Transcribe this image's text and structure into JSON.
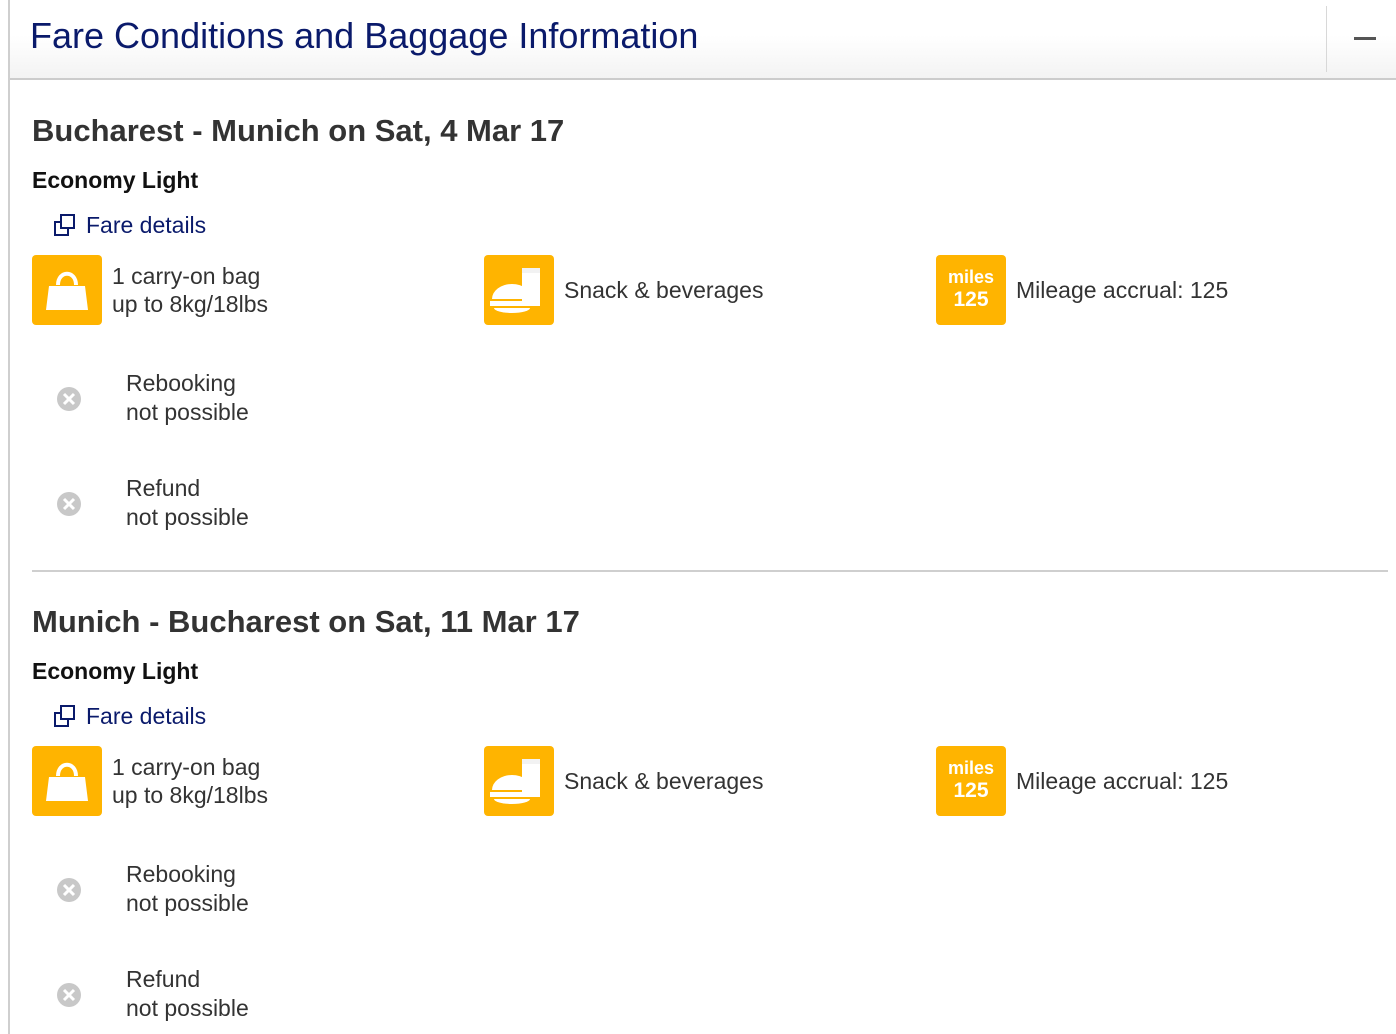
{
  "panel": {
    "title": "Fare Conditions and Baggage Information",
    "collapse_icon": "minus-icon"
  },
  "colors": {
    "accent": "#ffb400",
    "title_blue": "#0a1a6b",
    "text": "#333333",
    "disabled_icon": "#c8c8c8"
  },
  "flights": [
    {
      "route": "Bucharest - Munich on Sat, 4 Mar 17",
      "fare_name": "Economy Light",
      "fare_details_label": "Fare details",
      "baggage": {
        "icon": "handbag-icon",
        "line1": "1 carry-on bag",
        "line2": "up to 8kg/18lbs"
      },
      "meal": {
        "icon": "meal-icon",
        "text": "Snack & beverages"
      },
      "miles": {
        "tile_label": "miles",
        "tile_value": "125",
        "text": "Mileage accrual: 125"
      },
      "rebooking": {
        "icon": "x-circle-icon",
        "line1": "Rebooking",
        "line2": "not possible"
      },
      "refund": {
        "icon": "x-circle-icon",
        "line1": "Refund",
        "line2": "not possible"
      }
    },
    {
      "route": "Munich - Bucharest on Sat, 11 Mar 17",
      "fare_name": "Economy Light",
      "fare_details_label": "Fare details",
      "baggage": {
        "icon": "handbag-icon",
        "line1": "1 carry-on bag",
        "line2": "up to 8kg/18lbs"
      },
      "meal": {
        "icon": "meal-icon",
        "text": "Snack & beverages"
      },
      "miles": {
        "tile_label": "miles",
        "tile_value": "125",
        "text": "Mileage accrual: 125"
      },
      "rebooking": {
        "icon": "x-circle-icon",
        "line1": "Rebooking",
        "line2": "not possible"
      },
      "refund": {
        "icon": "x-circle-icon",
        "line1": "Refund",
        "line2": "not possible"
      }
    }
  ]
}
